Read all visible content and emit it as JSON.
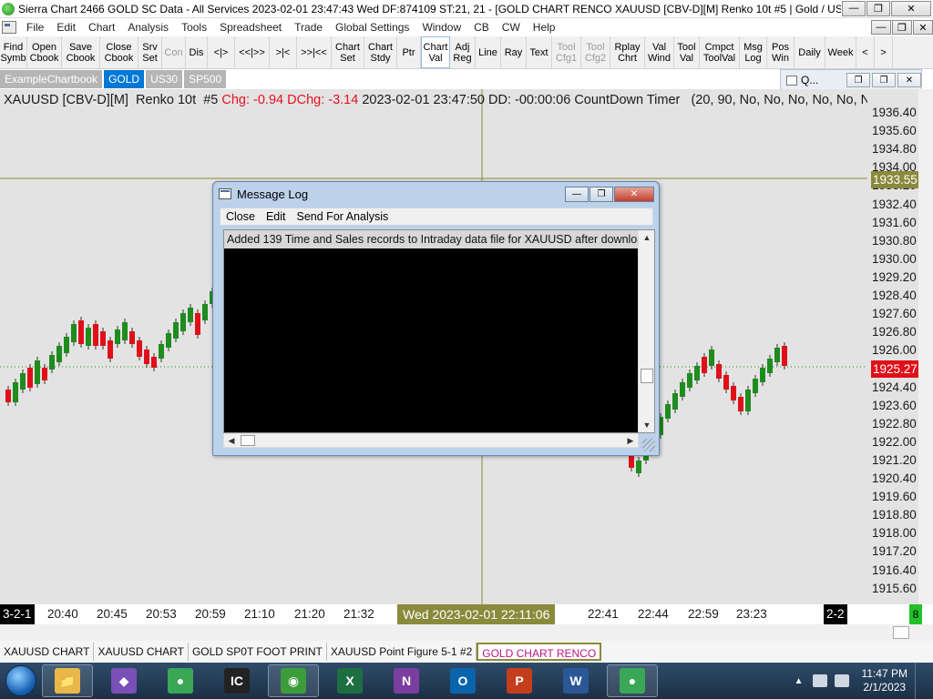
{
  "window": {
    "title": "Sierra Chart 2466 GOLD  SC Data - All Services 2023-02-01  23:47:43 Wed  DF:874109  ST:21, 21 - [GOLD CHART RENCO XAUUSD [CBV-D][M]  Renko 10t  #5 | Gold / US]",
    "minimize": "—",
    "maximize": "❐",
    "close": "✕"
  },
  "menu": {
    "items": [
      "File",
      "Edit",
      "Chart",
      "Analysis",
      "Tools",
      "Spreadsheet",
      "Trade",
      "Global Settings",
      "Window",
      "CB",
      "CW",
      "Help"
    ],
    "mdi_min": "—",
    "mdi_restore": "❐",
    "mdi_close": "✕"
  },
  "toolbar": {
    "buttons": [
      {
        "label": "Find\nSymb",
        "state": "normal"
      },
      {
        "label": "Open\nCbook",
        "state": "normal"
      },
      {
        "label": "Save\nCbook",
        "state": "normal"
      },
      {
        "label": "Close\nCbook",
        "state": "normal"
      },
      {
        "label": "Srv\nSet",
        "state": "normal"
      },
      {
        "label": "Con",
        "state": "disabled"
      },
      {
        "label": "Dis",
        "state": "normal"
      },
      {
        "label": "<|>",
        "state": "normal"
      },
      {
        "label": "<<|>>",
        "state": "normal"
      },
      {
        "label": ">|<",
        "state": "normal"
      },
      {
        "label": ">>|<<",
        "state": "normal"
      },
      {
        "label": "Chart\nSet",
        "state": "normal"
      },
      {
        "label": "Chart\nStdy",
        "state": "normal"
      },
      {
        "label": "Ptr",
        "state": "normal"
      },
      {
        "label": "Chart\nVal",
        "state": "active"
      },
      {
        "label": "Adj\nReg",
        "state": "normal"
      },
      {
        "label": "Line",
        "state": "normal"
      },
      {
        "label": "Ray",
        "state": "normal"
      },
      {
        "label": "Text",
        "state": "normal"
      },
      {
        "label": "Tool\nCfg1",
        "state": "disabled"
      },
      {
        "label": "Tool\nCfg2",
        "state": "disabled"
      },
      {
        "label": "Rplay\nChrt",
        "state": "normal"
      },
      {
        "label": "Val\nWind",
        "state": "normal"
      },
      {
        "label": "Tool\nVal",
        "state": "normal"
      },
      {
        "label": "Cmpct\nToolVal",
        "state": "normal"
      },
      {
        "label": "Msg\nLog",
        "state": "normal"
      },
      {
        "label": "Pos\nWin",
        "state": "normal"
      },
      {
        "label": "Daily",
        "state": "normal"
      },
      {
        "label": "Week",
        "state": "normal"
      },
      {
        "label": "<",
        "state": "normal"
      },
      {
        "label": ">",
        "state": "normal"
      }
    ]
  },
  "mini_window": {
    "title": "Q..."
  },
  "chartbook_tabs": [
    "ExampleChartbook",
    "GOLD",
    "US30",
    "SP500"
  ],
  "chart": {
    "symbol": "XAUUSD [CBV-D][M]",
    "bar_type": "Renko 10t",
    "number": "#5",
    "chg": "Chg: -0.94",
    "dchg": "DChg: -3.14",
    "datetime": "2023-02-01 23:47:50",
    "dd": "DD: -00:00:06 CountDown Timer",
    "params": "(20, 90, No, No, No, No, No, N",
    "colors": {
      "up": "#1e8c1e",
      "down": "#e0101a",
      "background": "#e3e3e3"
    }
  },
  "price_axis": {
    "labels": [
      "1936.40",
      "1935.60",
      "1934.80",
      "1934.00",
      "1933.20",
      "1932.40",
      "1931.60",
      "1930.80",
      "1930.00",
      "1929.20",
      "1928.40",
      "1927.60",
      "1926.80",
      "1926.00",
      "1925.20",
      "1924.40",
      "1923.60",
      "1922.80",
      "1922.00",
      "1921.20",
      "1920.40",
      "1919.60",
      "1918.80",
      "1918.00",
      "1917.20",
      "1916.40",
      "1915.60"
    ],
    "cursor_price": "1933.55",
    "last_price": "1925.27"
  },
  "time_axis": {
    "start": "3-2-1",
    "labels": [
      "20:40",
      "20:45",
      "20:53",
      "20:59",
      "21:10",
      "21:20",
      "21:32",
      "22:41",
      "22:44",
      "22:59",
      "23:23"
    ],
    "cursor_time": "Wed 2023-02-01  22:11:06",
    "end_label": "2-2",
    "green_marker": "8"
  },
  "chart_tabs": [
    "XAUUSD CHART",
    "XAUUSD CHART",
    "GOLD SP0T FOOT PRINT",
    "XAUUSD  Point  Figure 5-1  #2",
    "GOLD CHART RENCO"
  ],
  "message_log": {
    "title": "Message Log",
    "menu": [
      "Close",
      "Edit",
      "Send For Analysis"
    ],
    "lines": [
      "Added 139 Time and Sales records to Intraday data file for XAUUSD after download. | 2"
    ]
  },
  "taskbar": {
    "apps": [
      {
        "name": "file-explorer-icon",
        "glyph": "📁",
        "color": "#e8b84a"
      },
      {
        "name": "visual-studio-icon",
        "glyph": "◆",
        "color": "#7a4fb6"
      },
      {
        "name": "chrome-icon",
        "glyph": "●",
        "color": "#3aa757"
      },
      {
        "name": "ic-markets-icon",
        "glyph": "IC",
        "color": "#222222"
      },
      {
        "name": "sierra-chart-icon",
        "glyph": "◉",
        "color": "#3c9c3c"
      },
      {
        "name": "excel-icon",
        "glyph": "X",
        "color": "#1d6f42"
      },
      {
        "name": "onenote-icon",
        "glyph": "N",
        "color": "#7b3ea0"
      },
      {
        "name": "outlook-icon",
        "glyph": "O",
        "color": "#0a64ad"
      },
      {
        "name": "powerpoint-icon",
        "glyph": "P",
        "color": "#c43e1c"
      },
      {
        "name": "word-icon",
        "glyph": "W",
        "color": "#2b5797"
      },
      {
        "name": "chrome-badge-icon",
        "glyph": "●",
        "color": "#3aa757"
      }
    ],
    "time": "11:47 PM",
    "date": "2/1/2023"
  }
}
